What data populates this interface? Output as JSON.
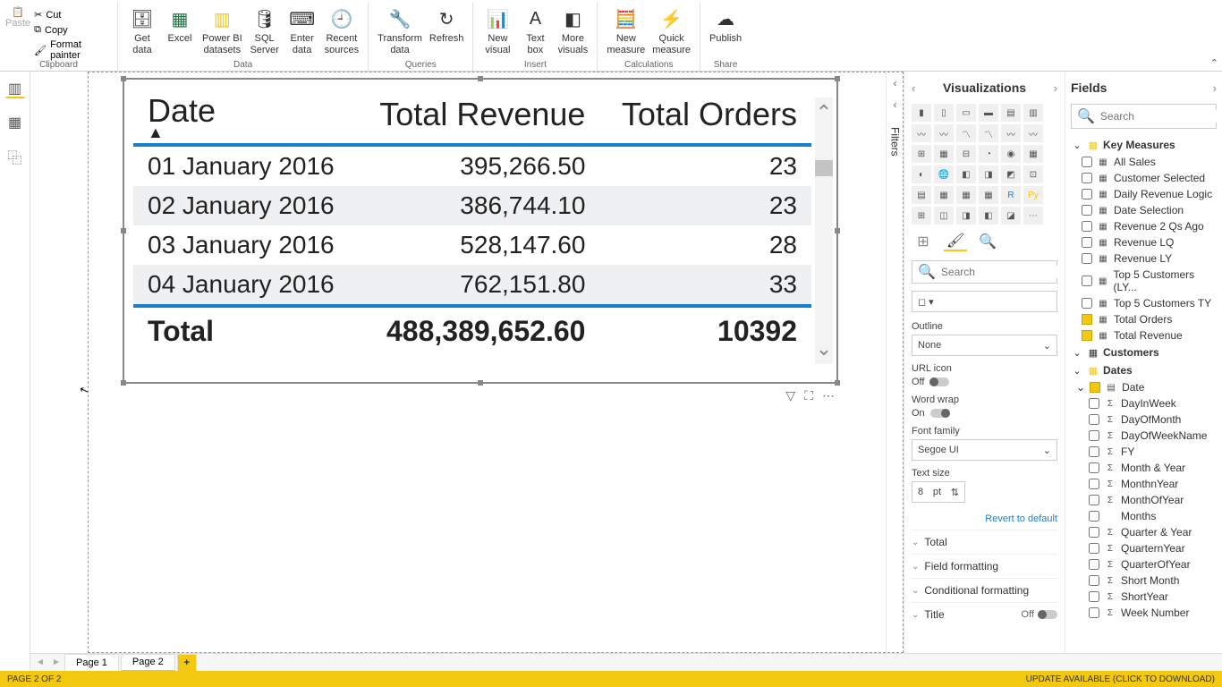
{
  "ribbon": {
    "clipboard": {
      "paste": "Paste",
      "cut": "Cut",
      "copy": "Copy",
      "format_painter": "Format painter",
      "group": "Clipboard"
    },
    "data": {
      "get_data": "Get\ndata",
      "excel": "Excel",
      "pbi_ds": "Power BI\ndatasets",
      "sql": "SQL\nServer",
      "enter": "Enter\ndata",
      "recent": "Recent\nsources",
      "group": "Data"
    },
    "queries": {
      "transform": "Transform\ndata",
      "refresh": "Refresh",
      "group": "Queries"
    },
    "insert": {
      "new_visual": "New\nvisual",
      "text_box": "Text\nbox",
      "more": "More\nvisuals",
      "group": "Insert"
    },
    "calc": {
      "new_measure": "New\nmeasure",
      "quick": "Quick\nmeasure",
      "group": "Calculations"
    },
    "share": {
      "publish": "Publish",
      "group": "Share"
    }
  },
  "table": {
    "headers": {
      "date": "Date",
      "revenue": "Total Revenue",
      "orders": "Total Orders"
    },
    "rows": [
      {
        "date": "01 January 2016",
        "revenue": "395,266.50",
        "orders": "23"
      },
      {
        "date": "02 January 2016",
        "revenue": "386,744.10",
        "orders": "23"
      },
      {
        "date": "03 January 2016",
        "revenue": "528,147.60",
        "orders": "28"
      },
      {
        "date": "04 January 2016",
        "revenue": "762,151.80",
        "orders": "33"
      }
    ],
    "total_label": "Total",
    "total_revenue": "488,389,652.60",
    "total_orders": "10392"
  },
  "viz": {
    "title": "Visualizations",
    "search": "Search",
    "outline_label": "Outline",
    "outline_value": "None",
    "url_icon": "URL icon",
    "off": "Off",
    "on": "On",
    "word_wrap": "Word wrap",
    "font_family_label": "Font family",
    "font_family_value": "Segoe UI",
    "text_size_label": "Text size",
    "text_size_value": "8",
    "text_size_unit": "pt",
    "revert": "Revert to default",
    "sections": {
      "total": "Total",
      "field_formatting": "Field formatting",
      "conditional": "Conditional formatting",
      "title": "Title"
    }
  },
  "filters_label": "Filters",
  "fields": {
    "title": "Fields",
    "search": "Search",
    "groups": {
      "key_measures": "Key Measures",
      "customers": "Customers",
      "dates": "Dates"
    },
    "measures": [
      {
        "name": "All Sales",
        "checked": false,
        "icon": "▦"
      },
      {
        "name": "Customer Selected",
        "checked": false,
        "icon": "▦"
      },
      {
        "name": "Daily Revenue Logic",
        "checked": false,
        "icon": "▦"
      },
      {
        "name": "Date Selection",
        "checked": false,
        "icon": "▦"
      },
      {
        "name": "Revenue 2 Qs Ago",
        "checked": false,
        "icon": "▦"
      },
      {
        "name": "Revenue LQ",
        "checked": false,
        "icon": "▦"
      },
      {
        "name": "Revenue LY",
        "checked": false,
        "icon": "▦"
      },
      {
        "name": "Top 5 Customers (LY...",
        "checked": false,
        "icon": "▦"
      },
      {
        "name": "Top 5 Customers TY",
        "checked": false,
        "icon": "▦"
      },
      {
        "name": "Total Orders",
        "checked": true,
        "icon": "▦"
      },
      {
        "name": "Total Revenue",
        "checked": true,
        "icon": "▦"
      }
    ],
    "date_sub": "Date",
    "date_fields": [
      {
        "name": "DayInWeek",
        "icon": "Σ"
      },
      {
        "name": "DayOfMonth",
        "icon": "Σ"
      },
      {
        "name": "DayOfWeekName",
        "icon": "Σ"
      },
      {
        "name": "FY",
        "icon": "Σ"
      },
      {
        "name": "Month & Year",
        "icon": "Σ"
      },
      {
        "name": "MonthnYear",
        "icon": "Σ"
      },
      {
        "name": "MonthOfYear",
        "icon": "Σ"
      },
      {
        "name": "Months",
        "icon": ""
      },
      {
        "name": "Quarter & Year",
        "icon": "Σ"
      },
      {
        "name": "QuarternYear",
        "icon": "Σ"
      },
      {
        "name": "QuarterOfYear",
        "icon": "Σ"
      },
      {
        "name": "Short Month",
        "icon": "Σ"
      },
      {
        "name": "ShortYear",
        "icon": "Σ"
      },
      {
        "name": "Week Number",
        "icon": "Σ"
      }
    ]
  },
  "tabs": {
    "page1": "Page 1",
    "page2": "Page 2"
  },
  "status": {
    "left": "PAGE 2 OF 2",
    "right": "UPDATE AVAILABLE (CLICK TO DOWNLOAD)"
  }
}
